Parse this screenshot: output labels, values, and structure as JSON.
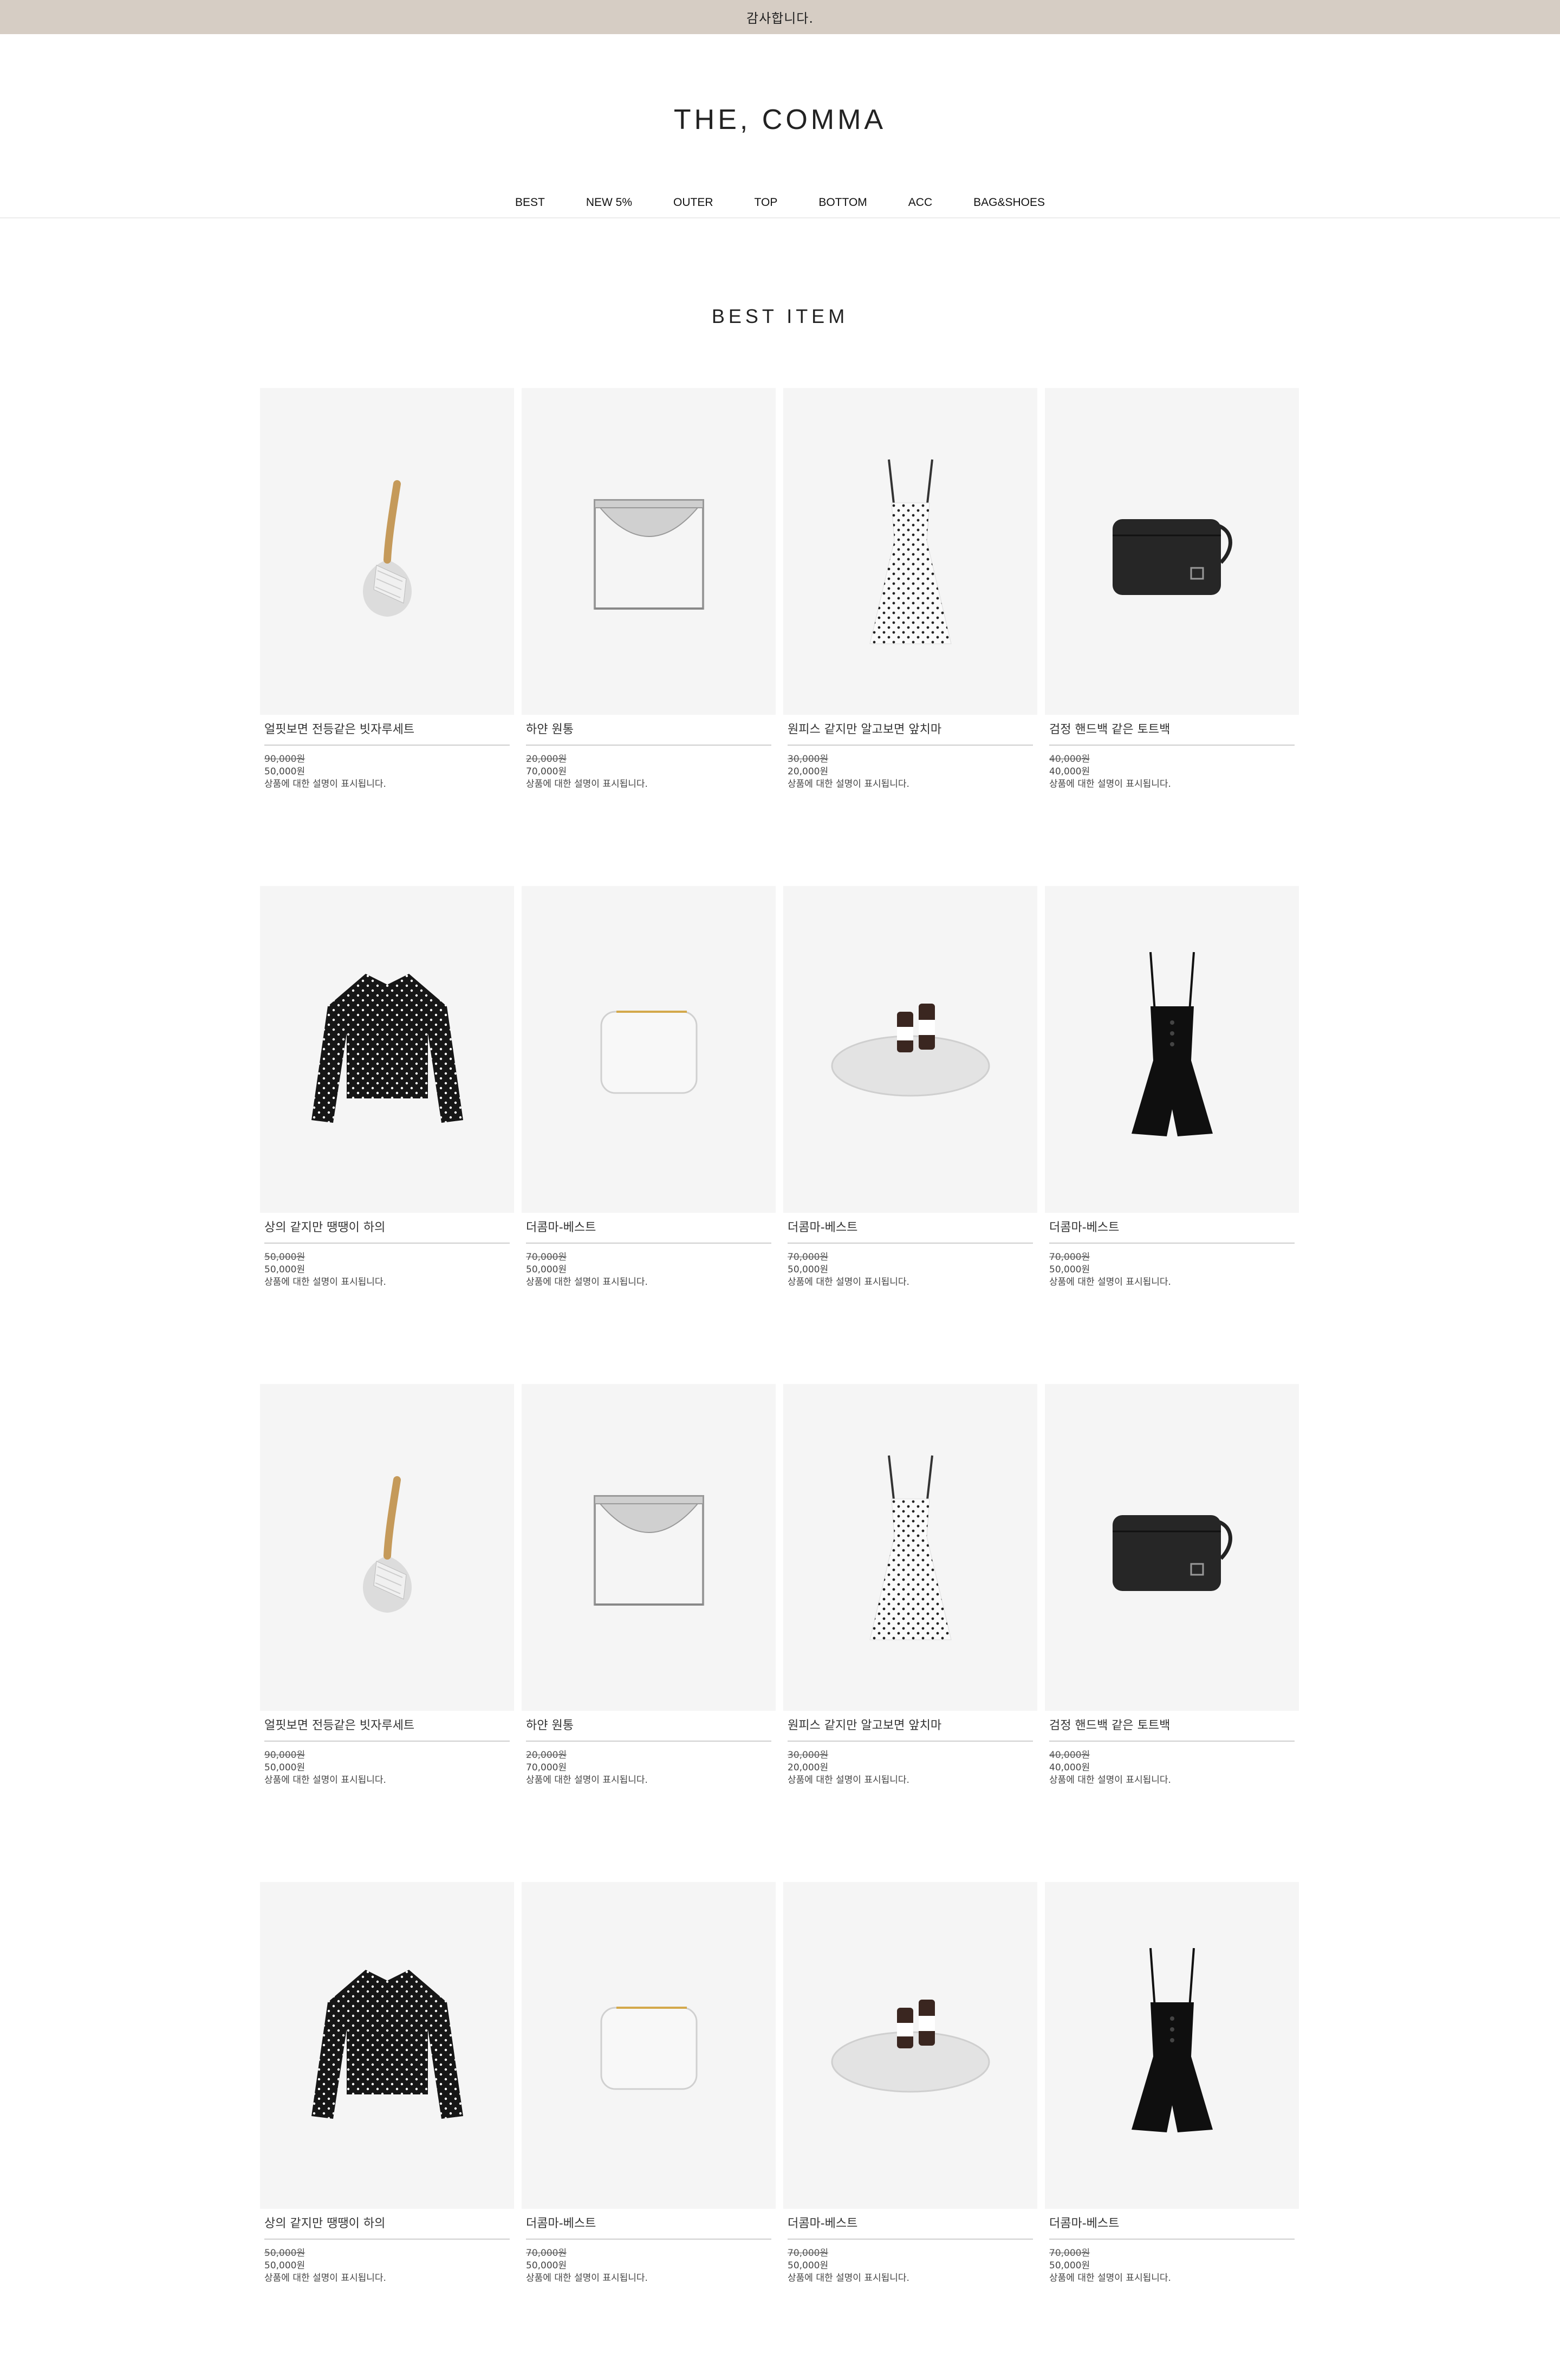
{
  "topbar": {
    "text": "감사합니다."
  },
  "header": {
    "logo": "THE, COMMA",
    "nav": [
      "BEST",
      "NEW 5%",
      "OUTER",
      "TOP",
      "BOTTOM",
      "ACC",
      "BAG&SHOES"
    ]
  },
  "section": {
    "title": "BEST ITEM"
  },
  "products": [
    {
      "name": "얼핏보면 전등같은 빗자루세트",
      "old": "90,000원",
      "price": "50,000원",
      "desc": "상품에 대한 설명이 표시됩니다.",
      "icon": "broom-set-icon"
    },
    {
      "name": "하얀 원통",
      "old": "20,000원",
      "price": "70,000원",
      "desc": "상품에 대한 설명이 표시됩니다.",
      "icon": "cube-bowl-icon"
    },
    {
      "name": "원피스 같지만 알고보면 앞치마",
      "old": "30,000원",
      "price": "20,000원",
      "desc": "상품에 대한 설명이 표시됩니다.",
      "icon": "polka-dress-icon"
    },
    {
      "name": "검정 핸드백 같은 토트백",
      "old": "40,000원",
      "price": "40,000원",
      "desc": "상품에 대한 설명이 표시됩니다.",
      "icon": "black-bag-icon"
    },
    {
      "name": "상의 같지만 땡땡이 하의",
      "old": "50,000원",
      "price": "50,000원",
      "desc": "상품에 대한 설명이 표시됩니다.",
      "icon": "polka-blouse-icon"
    },
    {
      "name": "더콤마-베스트",
      "old": "70,000원",
      "price": "50,000원",
      "desc": "상품에 대한 설명이 표시됩니다.",
      "icon": "white-wallet-icon"
    },
    {
      "name": "더콤마-베스트",
      "old": "70,000원",
      "price": "50,000원",
      "desc": "상품에 대한 설명이 표시됩니다.",
      "icon": "tray-bottles-icon"
    },
    {
      "name": "더콤마-베스트",
      "old": "70,000원",
      "price": "50,000원",
      "desc": "상품에 대한 설명이 표시됩니다.",
      "icon": "black-romper-icon"
    },
    {
      "name": "얼핏보면 전등같은 빗자루세트",
      "old": "90,000원",
      "price": "50,000원",
      "desc": "상품에 대한 설명이 표시됩니다.",
      "icon": "broom-set-icon"
    },
    {
      "name": "하얀 원통",
      "old": "20,000원",
      "price": "70,000원",
      "desc": "상품에 대한 설명이 표시됩니다.",
      "icon": "cube-bowl-icon"
    },
    {
      "name": "원피스 같지만 알고보면 앞치마",
      "old": "30,000원",
      "price": "20,000원",
      "desc": "상품에 대한 설명이 표시됩니다.",
      "icon": "polka-dress-icon"
    },
    {
      "name": "검정 핸드백 같은 토트백",
      "old": "40,000원",
      "price": "40,000원",
      "desc": "상품에 대한 설명이 표시됩니다.",
      "icon": "black-bag-icon"
    },
    {
      "name": "상의 같지만 땡땡이 하의",
      "old": "50,000원",
      "price": "50,000원",
      "desc": "상품에 대한 설명이 표시됩니다.",
      "icon": "polka-blouse-icon"
    },
    {
      "name": "더콤마-베스트",
      "old": "70,000원",
      "price": "50,000원",
      "desc": "상품에 대한 설명이 표시됩니다.",
      "icon": "white-wallet-icon"
    },
    {
      "name": "더콤마-베스트",
      "old": "70,000원",
      "price": "50,000원",
      "desc": "상품에 대한 설명이 표시됩니다.",
      "icon": "tray-bottles-icon"
    },
    {
      "name": "더콤마-베스트",
      "old": "70,000원",
      "price": "50,000원",
      "desc": "상품에 대한 설명이 표시됩니다.",
      "icon": "black-romper-icon"
    }
  ]
}
